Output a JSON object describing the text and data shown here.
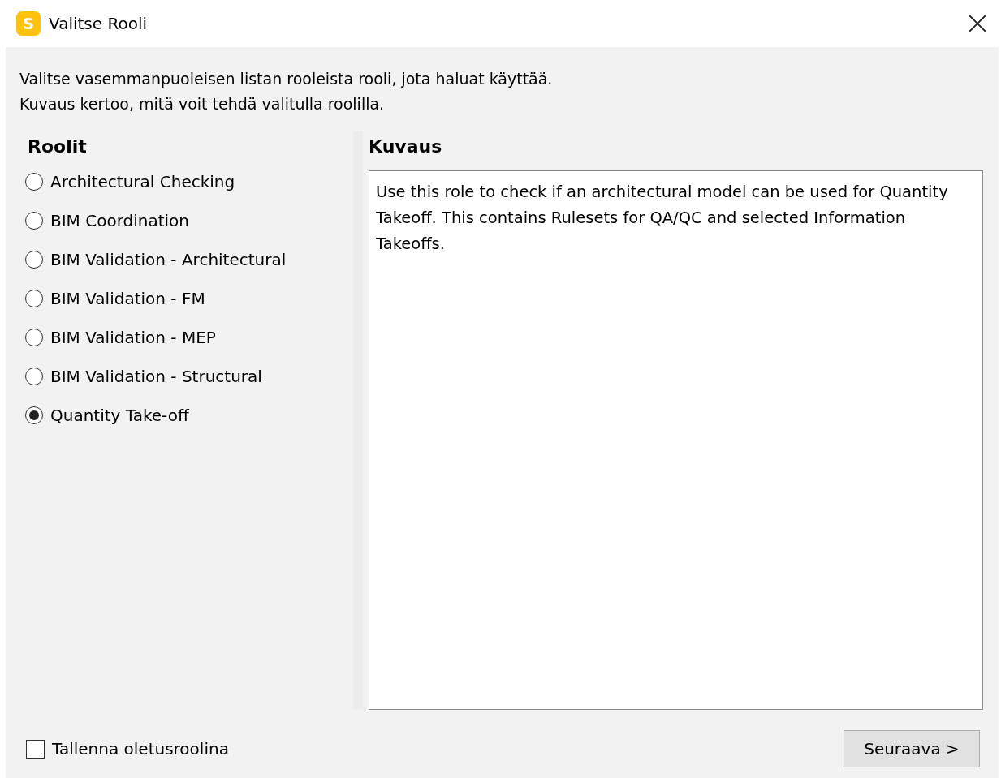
{
  "window": {
    "title": "Valitse Rooli",
    "app_icon_letter": "S"
  },
  "intro": [
    "Valitse vasemmanpuoleisen listan rooleista rooli, jota haluat käyttää.",
    "Kuvaus kertoo, mitä voit tehdä valitulla roolilla."
  ],
  "roles": {
    "heading": "Roolit",
    "items": [
      {
        "label": "Architectural Checking",
        "selected": false
      },
      {
        "label": "BIM Coordination",
        "selected": false
      },
      {
        "label": "BIM Validation - Architectural",
        "selected": false
      },
      {
        "label": "BIM Validation - FM",
        "selected": false
      },
      {
        "label": "BIM Validation - MEP",
        "selected": false
      },
      {
        "label": "BIM Validation - Structural",
        "selected": false
      },
      {
        "label": "Quantity Take-off",
        "selected": true
      }
    ]
  },
  "description": {
    "heading": "Kuvaus",
    "text": "Use this role to check if an architectural model can be used for Quantity Takeoff. This contains Rulesets for QA/QC and selected Information Takeoffs."
  },
  "save_default": {
    "label": "Tallenna oletusroolina",
    "checked": false
  },
  "buttons": [
    "Seuraava >"
  ]
}
